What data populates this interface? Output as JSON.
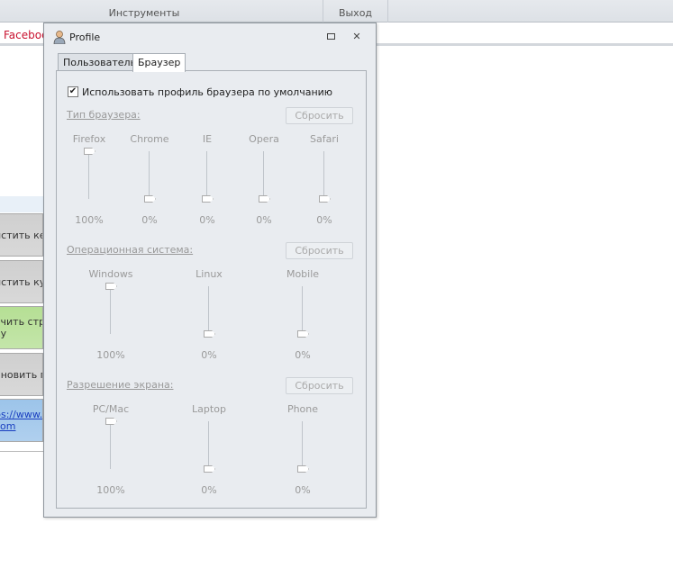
{
  "ribbon": {
    "groups": [
      "Инструменты",
      "Выход"
    ]
  },
  "tabstrip": {
    "active_tab": "Faceboo"
  },
  "left_buttons": [
    {
      "label": "истить кеш",
      "color": "#cfcfcf"
    },
    {
      "label": "истить куки",
      "color": "#cfcfcf"
    },
    {
      "label": "учить стр\nку",
      "color": "#b5df94"
    },
    {
      "label": "ановить п",
      "color": "#cfcfcf"
    },
    {
      "label": "ps://www.l\ncom",
      "color": "#9cc4ea"
    }
  ],
  "dialog": {
    "title": "Profile",
    "tabs": [
      "Пользователь",
      "Браузер"
    ],
    "active_tab": "Браузер",
    "use_default_checkbox": {
      "label": "Использовать профиль браузера по умолчанию",
      "checked": true
    },
    "reset_label": "Сбросить",
    "sections": [
      {
        "title": "Тип браузера:",
        "sliders": [
          {
            "label": "Firefox",
            "value": 100,
            "text": "100%"
          },
          {
            "label": "Chrome",
            "value": 0,
            "text": "0%"
          },
          {
            "label": "IE",
            "value": 0,
            "text": "0%"
          },
          {
            "label": "Opera",
            "value": 0,
            "text": "0%"
          },
          {
            "label": "Safari",
            "value": 0,
            "text": "0%"
          }
        ]
      },
      {
        "title": "Операционная система:",
        "sliders": [
          {
            "label": "Windows",
            "value": 100,
            "text": "100%"
          },
          {
            "label": "Linux",
            "value": 0,
            "text": "0%"
          },
          {
            "label": "Mobile",
            "value": 0,
            "text": "0%"
          }
        ]
      },
      {
        "title": "Разрешение экрана:",
        "sliders": [
          {
            "label": "PC/Mac",
            "value": 100,
            "text": "100%"
          },
          {
            "label": "Laptop",
            "value": 0,
            "text": "0%"
          },
          {
            "label": "Phone",
            "value": 0,
            "text": "0%"
          }
        ]
      }
    ]
  }
}
